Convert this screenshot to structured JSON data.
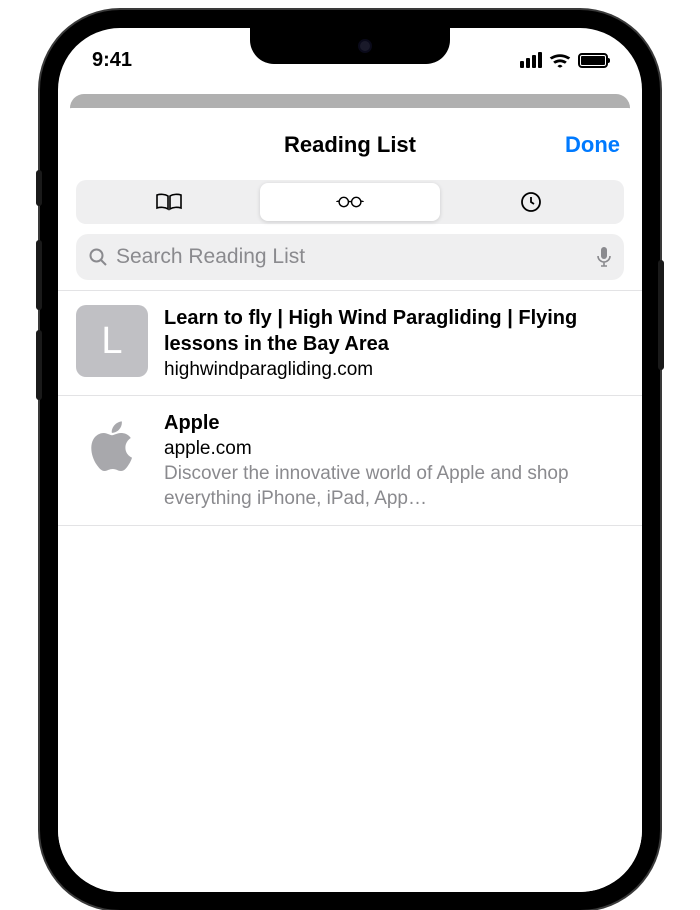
{
  "status_bar": {
    "time": "9:41"
  },
  "sheet": {
    "title": "Reading List",
    "done": "Done"
  },
  "tabs": {
    "bookmarks": "bookmarks",
    "reading_list": "reading-list",
    "history": "history",
    "selected": "reading-list"
  },
  "search": {
    "placeholder": "Search Reading List"
  },
  "items": [
    {
      "initial": "L",
      "title": "Learn to fly | High Wind Paragliding | Flying lessons in the Bay Area",
      "domain": "highwindparagliding.com",
      "description": "",
      "icon": "letter"
    },
    {
      "initial": "",
      "title": "Apple",
      "domain": "apple.com",
      "description": "Discover the innovative world of Apple and shop everything iPhone, iPad, App…",
      "icon": "apple"
    }
  ]
}
